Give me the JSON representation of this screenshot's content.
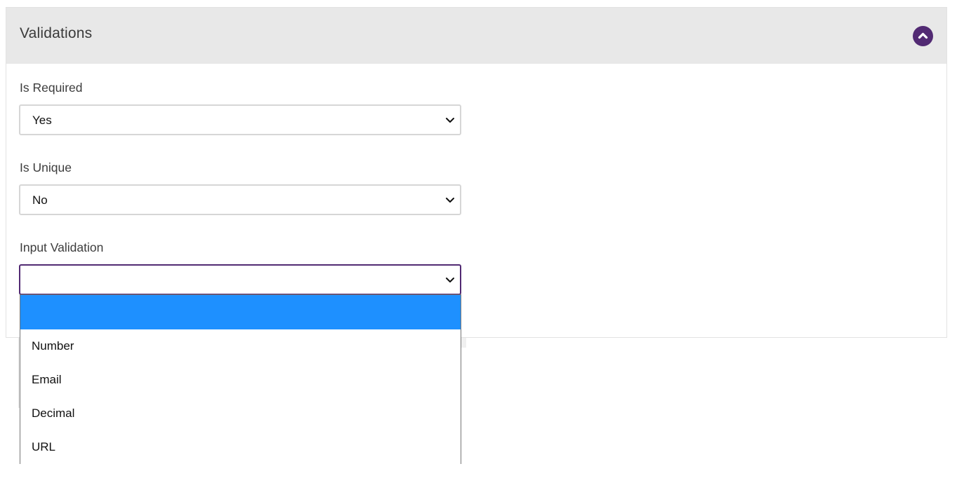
{
  "panel": {
    "title": "Validations",
    "collapse_icon": "chevron-up-icon",
    "accent_color": "#522a73"
  },
  "fields": {
    "is_required": {
      "label": "Is Required",
      "value": "Yes"
    },
    "is_unique": {
      "label": "Is Unique",
      "value": "No"
    },
    "input_validation": {
      "label": "Input Validation",
      "value": "",
      "options": [
        "",
        "Number",
        "Email",
        "Decimal",
        "URL"
      ],
      "highlight_color": "#1e90ff"
    }
  }
}
